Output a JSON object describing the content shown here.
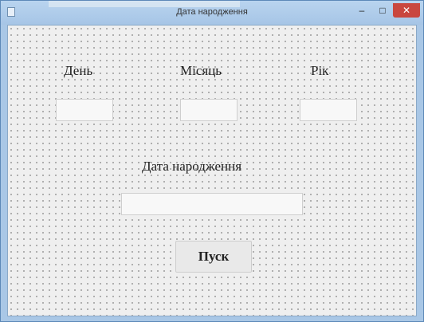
{
  "window": {
    "title": "Дата народження",
    "min_glyph": "–",
    "max_glyph": "□",
    "close_glyph": "✕"
  },
  "form": {
    "day_label": "День",
    "month_label": "Місяць",
    "year_label": "Рік",
    "birth_label": "Дата народження",
    "day_value": "",
    "month_value": "",
    "year_value": "",
    "birth_value": "",
    "run_button": "Пуск"
  }
}
